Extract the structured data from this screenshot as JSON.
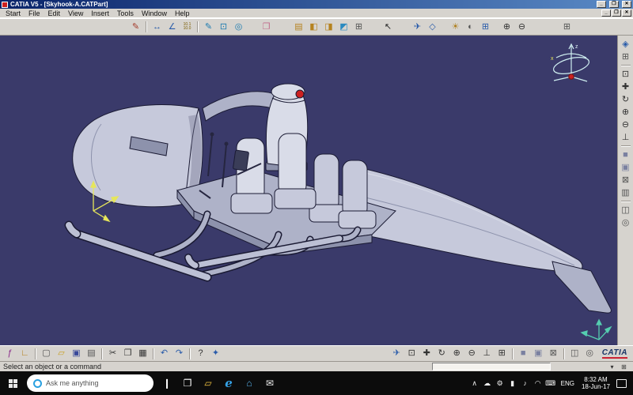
{
  "colors": {
    "viewport-bg": "#3a3a6a",
    "chrome": "#d6d3ce",
    "taskbar": "#0c0c0c",
    "model-base": "#c6c9db",
    "model-light": "#d9dce8",
    "model-dark": "#aeb2c8",
    "model-deep": "#8d92ac",
    "model-outline": "#1a1a33",
    "skid": "#bcc0d4",
    "accent-red": "#cc2020",
    "compass": "#cfeef0",
    "triad-yellow": "#e6e65a",
    "triad-teal": "#55cdb0",
    "titlebar-start": "#0a246a",
    "titlebar-end": "#5a8ac6"
  },
  "titlebar": {
    "title": "CATIA V5 - [Skyhook-A.CATPart]",
    "min_glyph": "_",
    "max_glyph": "❒",
    "close_glyph": "✕"
  },
  "menubar": {
    "items": [
      "Start",
      "File",
      "Edit",
      "View",
      "Insert",
      "Tools",
      "Window",
      "Help"
    ],
    "child_min": "_",
    "child_restore": "❒",
    "child_close": "✕"
  },
  "toolbar_top": {
    "icons": [
      {
        "type": "gap",
        "w": 160
      },
      {
        "name": "paint-properties-icon",
        "glyph": "✎",
        "color": "#a33a2a"
      },
      {
        "type": "sep"
      },
      {
        "name": "measure-between-icon",
        "glyph": "↔",
        "color": "#2a5caa"
      },
      {
        "name": "measure-item-icon",
        "glyph": "∠",
        "color": "#2a5caa"
      },
      {
        "name": "measure-readout-icon",
        "lines": [
          "10.1",
          "10.0"
        ]
      },
      {
        "type": "sep"
      },
      {
        "name": "sketcher-icon",
        "glyph": "✎",
        "color": "#1a7ab0"
      },
      {
        "name": "pad-icon",
        "glyph": "⊡",
        "color": "#1a7ab0"
      },
      {
        "name": "shaft-icon",
        "glyph": "◎",
        "color": "#1a7ab0"
      },
      {
        "type": "gap",
        "w": 16
      },
      {
        "name": "eraser-icon",
        "glyph": "❐",
        "color": "#c06a8a"
      },
      {
        "type": "gap",
        "w": 22
      },
      {
        "name": "catalog-browser-icon",
        "glyph": "▤",
        "color": "#b5821e"
      },
      {
        "name": "photo-studio-icon",
        "glyph": "◧",
        "color": "#b5821e"
      },
      {
        "name": "render-icon",
        "glyph": "◨",
        "color": "#b5821e"
      },
      {
        "name": "apply-material-icon",
        "glyph": "◩",
        "color": "#2a8ac0"
      },
      {
        "name": "graph-tree-icon",
        "glyph": "⊞",
        "color": "#555555"
      },
      {
        "type": "gap",
        "w": 18
      },
      {
        "name": "select-icon",
        "glyph": "↖",
        "color": "#222222"
      },
      {
        "type": "gap",
        "w": 18
      },
      {
        "name": "fly-mode-icon",
        "glyph": "✈",
        "color": "#2a5caa"
      },
      {
        "name": "examine-mode-icon",
        "glyph": "◇",
        "color": "#2a5caa"
      },
      {
        "type": "gap",
        "w": 10
      },
      {
        "name": "light-effect-icon",
        "glyph": "☀",
        "color": "#b08020"
      },
      {
        "name": "depth-effect-icon",
        "glyph": "◐",
        "color": "#555555"
      },
      {
        "name": "grid-icon",
        "glyph": "⊞",
        "color": "#2a5caa"
      },
      {
        "type": "gap",
        "w": 8
      },
      {
        "name": "zoom-in-icon",
        "glyph": "⊕",
        "color": "#333333"
      },
      {
        "name": "zoom-out-icon",
        "glyph": "⊖",
        "color": "#333333"
      },
      {
        "type": "gap",
        "w": 38
      },
      {
        "name": "more-tools-icon",
        "glyph": "⊞",
        "color": "#555555"
      }
    ]
  },
  "sidebar_right": {
    "icons": [
      {
        "name": "iso-view-icon",
        "glyph": "◈",
        "color": "#2a5caa"
      },
      {
        "name": "multi-view-icon",
        "glyph": "⊞",
        "color": "#555555"
      },
      {
        "type": "sep"
      },
      {
        "name": "fit-all-icon",
        "glyph": "⊡",
        "color": "#333333"
      },
      {
        "name": "pan-icon",
        "glyph": "✚",
        "color": "#333333"
      },
      {
        "name": "rotate-icon",
        "glyph": "↻",
        "color": "#333333"
      },
      {
        "name": "zoom-in-icon",
        "glyph": "⊕",
        "color": "#333333"
      },
      {
        "name": "zoom-out-icon",
        "glyph": "⊖",
        "color": "#333333"
      },
      {
        "name": "normal-view-icon",
        "glyph": "⊥",
        "color": "#333333"
      },
      {
        "type": "sep"
      },
      {
        "name": "shading-icon",
        "glyph": "■",
        "color": "#7a80a0"
      },
      {
        "name": "shading-edges-icon",
        "glyph": "▣",
        "color": "#7a80a0"
      },
      {
        "name": "wireframe-icon",
        "glyph": "⊠",
        "color": "#555555"
      },
      {
        "name": "hidden-line-icon",
        "glyph": "▥",
        "color": "#555555"
      },
      {
        "type": "sep"
      },
      {
        "name": "hide-show-icon",
        "glyph": "◫",
        "color": "#555555"
      },
      {
        "name": "swap-space-icon",
        "glyph": "◎",
        "color": "#555555"
      }
    ]
  },
  "toolbar_bottom": {
    "left_icons": [
      {
        "name": "knowledge-formula-icon",
        "glyph": "ƒ",
        "color": "#8a2a8a"
      },
      {
        "name": "axis-system-icon",
        "glyph": "∟",
        "color": "#b5821e"
      },
      {
        "type": "sep"
      },
      {
        "name": "new-file-icon",
        "glyph": "▢",
        "color": "#555555"
      },
      {
        "name": "open-file-icon",
        "glyph": "▱",
        "color": "#c8a020"
      },
      {
        "name": "save-icon",
        "glyph": "▣",
        "color": "#3a4a9a"
      },
      {
        "name": "print-icon",
        "glyph": "▤",
        "color": "#555555"
      },
      {
        "type": "sep"
      },
      {
        "name": "cut-icon",
        "glyph": "✂",
        "color": "#333333"
      },
      {
        "name": "copy-icon",
        "glyph": "❐",
        "color": "#333333"
      },
      {
        "name": "paste-icon",
        "glyph": "▦",
        "color": "#333333"
      },
      {
        "type": "sep"
      },
      {
        "name": "undo-icon",
        "glyph": "↶",
        "color": "#2a5caa"
      },
      {
        "name": "redo-icon",
        "glyph": "↷",
        "color": "#2a5caa"
      },
      {
        "type": "sep"
      },
      {
        "name": "help-icon",
        "glyph": "?",
        "color": "#333333"
      },
      {
        "name": "hyperlink-icon",
        "glyph": "✦",
        "color": "#2a5caa"
      }
    ],
    "right_icons": [
      {
        "name": "fly-icon",
        "glyph": "✈",
        "color": "#2a5caa"
      },
      {
        "name": "fit-all-in-icon",
        "glyph": "⊡",
        "color": "#333333"
      },
      {
        "name": "pan-icon",
        "glyph": "✚",
        "color": "#333333"
      },
      {
        "name": "rotate-icon",
        "glyph": "↻",
        "color": "#333333"
      },
      {
        "name": "zoom-in-icon",
        "glyph": "⊕",
        "color": "#333333"
      },
      {
        "name": "zoom-out-icon",
        "glyph": "⊖",
        "color": "#333333"
      },
      {
        "name": "normal-view-icon",
        "glyph": "⊥",
        "color": "#333333"
      },
      {
        "name": "create-views-icon",
        "glyph": "⊞",
        "color": "#333333"
      },
      {
        "type": "sep"
      },
      {
        "name": "shading-icon",
        "glyph": "■",
        "color": "#7a80a0"
      },
      {
        "name": "shading-edges-icon",
        "glyph": "▣",
        "color": "#7a80a0"
      },
      {
        "name": "wireframe-icon",
        "glyph": "⊠",
        "color": "#555555"
      },
      {
        "type": "sep"
      },
      {
        "name": "hide-show-icon",
        "glyph": "◫",
        "color": "#555555"
      },
      {
        "name": "swap-visible-space-icon",
        "glyph": "◎",
        "color": "#555555"
      }
    ],
    "brand": "CATIA"
  },
  "statusbar": {
    "message": "Select an object or a command",
    "command_value": "",
    "icons": [
      {
        "name": "dialog-expand-icon",
        "glyph": "▾",
        "color": "#333333"
      },
      {
        "name": "power-input-toggle-icon",
        "glyph": "⊞",
        "color": "#333333"
      }
    ]
  },
  "taskbar": {
    "search_placeholder": "Ask me anything",
    "left_icons": [
      {
        "name": "cortana-mic-icon",
        "glyph": "❙",
        "color": "#ffffff"
      },
      {
        "name": "task-view-icon",
        "glyph": "❐",
        "color": "#ffffff"
      },
      {
        "name": "file-explorer-icon",
        "glyph": "▱",
        "color": "#f0c040"
      },
      {
        "name": "edge-icon",
        "glyph": "e",
        "cls": "edge",
        "color": "#35a3e8"
      },
      {
        "name": "store-icon",
        "glyph": "⌂",
        "color": "#58b0e8"
      },
      {
        "name": "mail-icon",
        "glyph": "✉",
        "color": "#eeeeee"
      }
    ],
    "tray_icons": [
      {
        "name": "hidden-icons-chevron",
        "glyph": "∧",
        "color": "#eeeeee"
      },
      {
        "name": "onedrive-icon",
        "glyph": "☁",
        "color": "#eeeeee"
      },
      {
        "name": "settings-tray-icon",
        "glyph": "⚙",
        "color": "#eeeeee"
      },
      {
        "name": "battery-icon",
        "glyph": "▮",
        "color": "#eeeeee"
      },
      {
        "name": "volume-icon",
        "glyph": "♪",
        "color": "#eeeeee"
      },
      {
        "name": "network-icon",
        "glyph": "◠",
        "color": "#eeeeee"
      },
      {
        "name": "keyboard-icon",
        "glyph": "⌨",
        "color": "#eeeeee"
      }
    ],
    "tray_language": "ENG",
    "tray_time": "8:32 AM",
    "tray_date": "18-Jun-17"
  },
  "viewport": {
    "compass": {
      "z_label": "z",
      "x_label": "x"
    }
  }
}
